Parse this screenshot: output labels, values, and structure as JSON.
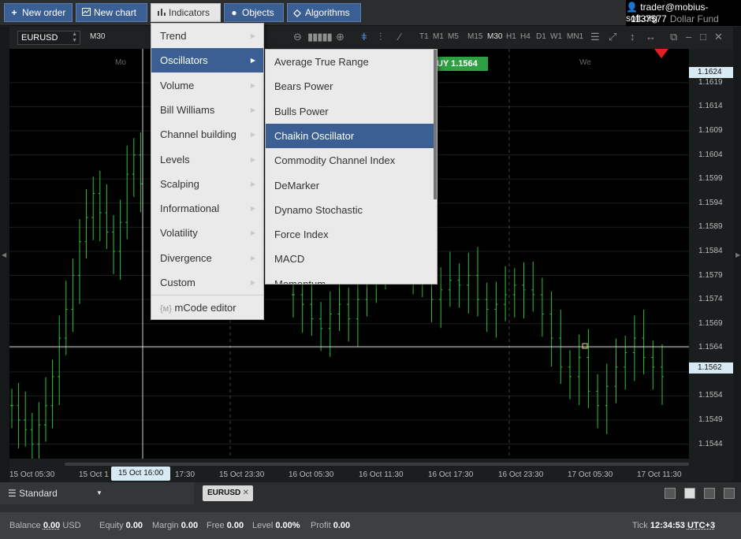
{
  "toolbar": {
    "new_order": "New order",
    "new_chart": "New chart",
    "indicators": "Indicators",
    "objects": "Objects",
    "algorithms": "Algorithms"
  },
  "account": {
    "user": "trader@mobius-soft.org",
    "number": "1137577",
    "fund": "Dollar Fund"
  },
  "chart": {
    "symbol": "EURUSD",
    "timeframe": "M30",
    "timeframes": [
      "T1",
      "M1",
      "M5",
      "M15",
      "M30",
      "H1",
      "H4",
      "D1",
      "W1",
      "MN1"
    ],
    "active_timeframe": "M30",
    "buy_label": "UY 1.1564",
    "day_labels": [
      "Mo",
      "We"
    ],
    "crosshair_time": "15 Oct 16:00",
    "current_price_tag": "1.1624",
    "crosshair_price_tag": "1.1562"
  },
  "chart_data": {
    "type": "ohlc",
    "symbol": "EURUSD",
    "timeframe": "M30",
    "price_ticks": [
      "1.1619",
      "1.1614",
      "1.1609",
      "1.1604",
      "1.1599",
      "1.1594",
      "1.1589",
      "1.1584",
      "1.1579",
      "1.1574",
      "1.1569",
      "1.1564",
      "1.1559",
      "1.1554",
      "1.1549",
      "1.1544"
    ],
    "time_ticks": [
      "15 Oct 05:30",
      "15 Oct 1",
      "17:30",
      "15 Oct 23:30",
      "16 Oct 05:30",
      "16 Oct 11:30",
      "16 Oct 17:30",
      "16 Oct 23:30",
      "17 Oct 05:30",
      "17 Oct 11:30"
    ],
    "ylim": [
      1.1541,
      1.1626
    ],
    "closes_left": [
      1.1552,
      1.1549,
      1.1547,
      1.1544,
      1.1548,
      1.1552,
      1.1558,
      1.1566,
      1.1572,
      1.1579,
      1.1586,
      1.1591,
      1.1596,
      1.1592,
      1.1588,
      1.1584,
      1.159,
      1.16,
      1.1604,
      1.1598
    ],
    "closes_mid": [
      1.1575,
      1.1573,
      1.157,
      1.1568,
      1.1571,
      1.1573,
      1.157,
      1.1574,
      1.1578,
      1.1582,
      1.1585,
      1.1588,
      1.1583,
      1.1581,
      1.1578,
      1.1574,
      1.1576,
      1.1578,
      1.1577,
      1.1579,
      1.1574,
      1.1572,
      1.1573,
      1.1575,
      1.1577,
      1.1576,
      1.1575,
      1.1571,
      1.1566,
      1.156,
      1.1558,
      1.1562,
      1.1555,
      1.1552,
      1.1556,
      1.156,
      1.1563,
      1.1566,
      1.1562,
      1.156,
      1.1558
    ]
  },
  "indicators_menu": {
    "items": [
      {
        "label": "Trend",
        "arrow": "▶"
      },
      {
        "label": "Oscillators",
        "arrow": "▶"
      },
      {
        "label": "Volume",
        "arrow": "▶"
      },
      {
        "label": "Bill Williams",
        "arrow": "▶"
      },
      {
        "label": "Channel building",
        "arrow": "▶"
      },
      {
        "label": "Levels",
        "arrow": "▶"
      },
      {
        "label": "Scalping",
        "arrow": "▶"
      },
      {
        "label": "Informational",
        "arrow": "▶"
      },
      {
        "label": "Volatility",
        "arrow": "▶"
      },
      {
        "label": "Divergence",
        "arrow": "▶"
      },
      {
        "label": "Custom",
        "arrow": "▶"
      }
    ],
    "mcode_icon": "{м}",
    "mcode": "mCode editor",
    "selected_index": 1
  },
  "oscillators_menu": {
    "items": [
      "Average True Range",
      "Bears Power",
      "Bulls Power",
      "Chaikin Oscillator",
      "Commodity Channel Index",
      "DeMarker",
      "Dynamo Stochastic",
      "Force Index",
      "MACD",
      "Momentum"
    ],
    "selected_index": 3
  },
  "tabs": {
    "workspace": "Standard",
    "symbol_tab": "EURUSD",
    "close_glyph": "✕"
  },
  "status": {
    "balance_label": "Balance",
    "balance_value": "0.00",
    "currency": "USD",
    "equity_label": "Equity",
    "equity_value": "0.00",
    "margin_label": "Margin",
    "margin_value": "0.00",
    "free_label": "Free",
    "free_value": "0.00",
    "level_label": "Level",
    "level_value": "0.00%",
    "profit_label": "Profit",
    "profit_value": "0.00",
    "tick_label": "Tick",
    "tick_value": "12:34:53",
    "timezone": "UTC+3"
  },
  "colors": {
    "accent": "#3b5f93",
    "candle": "#2fbf3a",
    "buy": "#2ea043",
    "down_marker": "#e02020"
  }
}
